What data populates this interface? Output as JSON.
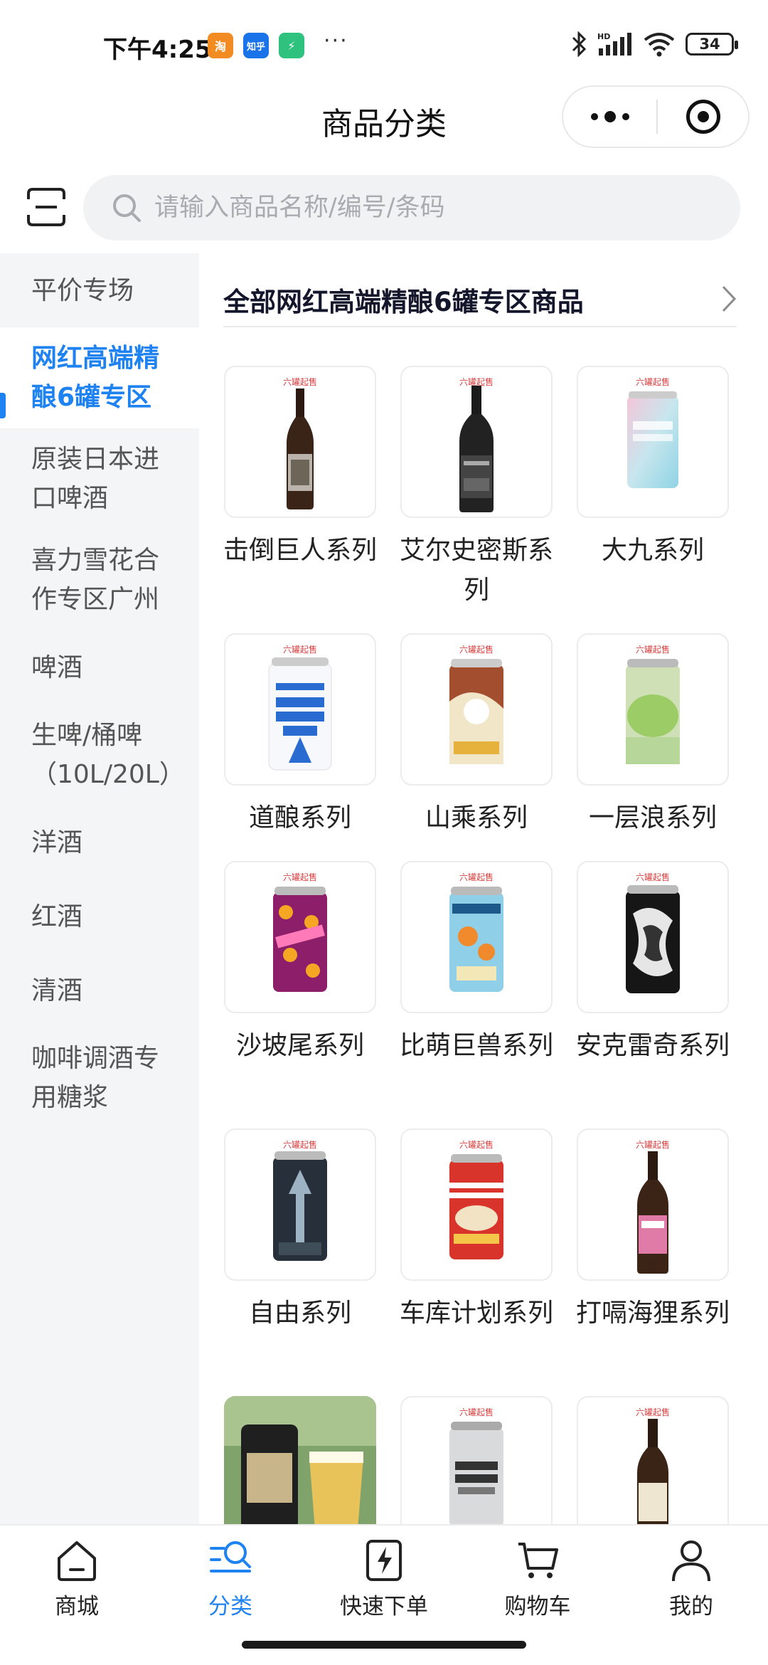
{
  "status_bar": {
    "time": "下午4:25",
    "apps": [
      "淘",
      "知乎",
      "⚡"
    ],
    "more": "···",
    "battery": "34"
  },
  "header": {
    "title": "商品分类"
  },
  "search": {
    "placeholder": "请输入商品名称/编号/条码"
  },
  "sidebar": {
    "items": [
      {
        "label": "平价专场"
      },
      {
        "label": "网红高端精酿6罐专区"
      },
      {
        "label": "原装日本进口啤酒"
      },
      {
        "label": "喜力雪花合作专区广州"
      },
      {
        "label": "啤酒"
      },
      {
        "label": "生啤/桶啤（10L/20L）"
      },
      {
        "label": "洋酒"
      },
      {
        "label": "红酒"
      },
      {
        "label": "清酒"
      },
      {
        "label": "咖啡调酒专用糖浆"
      }
    ],
    "active_index": 1
  },
  "section": {
    "title": "全部网红高端精酿6罐专区商品"
  },
  "products": [
    {
      "label": "击倒巨人系列",
      "icon": "dark-bottle"
    },
    {
      "label": "艾尔史密斯系列",
      "icon": "dark-bottle"
    },
    {
      "label": "大九系列",
      "icon": "pastel-can"
    },
    {
      "label": "道酿系列",
      "icon": "white-can"
    },
    {
      "label": "山乘系列",
      "icon": "illustrated-can"
    },
    {
      "label": "一层浪系列",
      "icon": "green-can"
    },
    {
      "label": "沙坡尾系列",
      "icon": "pink-can"
    },
    {
      "label": "比萌巨兽系列",
      "icon": "blue-can"
    },
    {
      "label": "安克雷奇系列",
      "icon": "black-can"
    },
    {
      "label": "自由系列",
      "icon": "dark-can"
    },
    {
      "label": "车库计划系列",
      "icon": "red-can"
    },
    {
      "label": "打嗝海狸系列",
      "icon": "dark-bottle"
    },
    {
      "label": "",
      "icon": "photo"
    },
    {
      "label": "",
      "icon": "silver-can"
    },
    {
      "label": "",
      "icon": "dark-bottle"
    }
  ],
  "thumb_tag": "六罐起售",
  "tabbar": {
    "tabs": [
      {
        "label": "商城",
        "icon": "home-icon"
      },
      {
        "label": "分类",
        "icon": "category-search-icon"
      },
      {
        "label": "快速下单",
        "icon": "lightning-order-icon"
      },
      {
        "label": "购物车",
        "icon": "cart-icon"
      },
      {
        "label": "我的",
        "icon": "profile-icon"
      }
    ],
    "active_index": 1
  },
  "colors": {
    "accent": "#1e82f0",
    "sidebar_bg": "#f4f5f7",
    "search_bg": "#f1f2f4"
  }
}
